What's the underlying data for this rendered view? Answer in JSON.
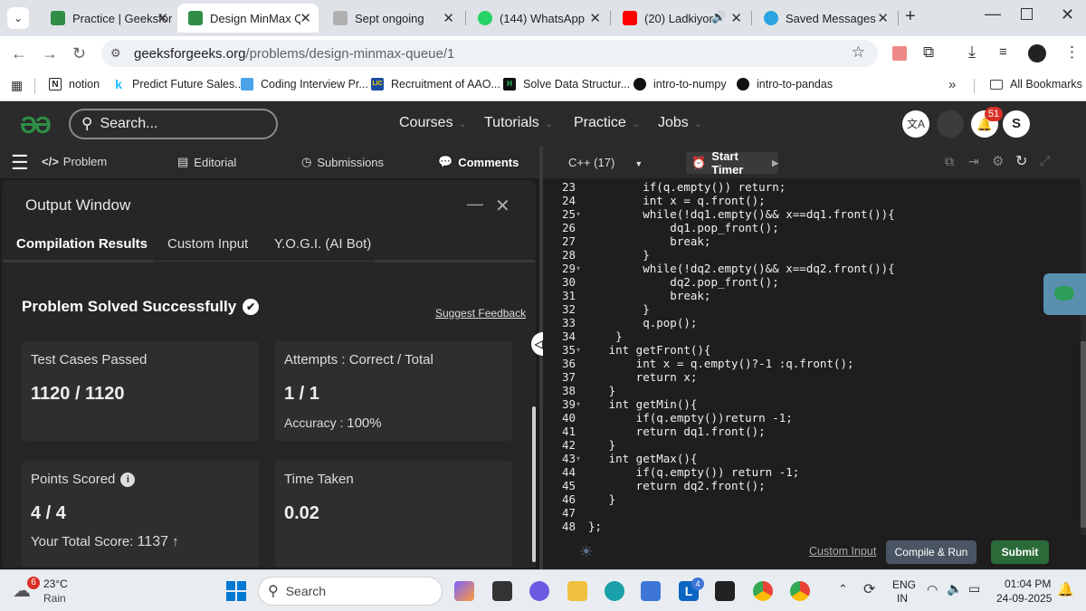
{
  "browser": {
    "tabs": [
      {
        "label": "Practice | Geeksfor",
        "color": "#2f8d46"
      },
      {
        "label": "Design MinMax Qu",
        "color": "#2f8d46",
        "active": true
      },
      {
        "label": "Sept ongoing",
        "color": "#9a9a9a"
      },
      {
        "label": "(144) WhatsApp",
        "color": "#25d366"
      },
      {
        "label": "(20) Ladkiyon k",
        "color": "#ff0000"
      },
      {
        "label": "Saved Messages",
        "color": "#2aa3e0"
      }
    ],
    "url_host": "geeksforgeeks.org",
    "url_path": "/problems/design-minmax-queue/1",
    "bookmarks": [
      {
        "label": "notion"
      },
      {
        "label": "Predict Future Sales..."
      },
      {
        "label": "Coding Interview Pr..."
      },
      {
        "label": "Recruitment of AAO..."
      },
      {
        "label": "Solve Data Structur..."
      },
      {
        "label": "intro-to-numpy"
      },
      {
        "label": "intro-to-pandas"
      }
    ],
    "all_bookmarks": "All Bookmarks"
  },
  "gfg": {
    "search_placeholder": "Search...",
    "menu": [
      "Courses",
      "Tutorials",
      "Practice",
      "Jobs"
    ],
    "notification_count": "51",
    "avatar_letter": "S"
  },
  "left_tabs": [
    "Problem",
    "Editorial",
    "Submissions",
    "Comments"
  ],
  "output": {
    "title": "Output Window",
    "subtabs": [
      "Compilation Results",
      "Custom Input",
      "Y.O.G.I. (AI Bot)"
    ],
    "success": "Problem Solved Successfully",
    "suggest_feedback": "Suggest Feedback",
    "test_cases_label": "Test Cases Passed",
    "test_cases_value": "1120 / 1120",
    "attempts_label": "Attempts : Correct / Total",
    "attempts_value": "1 / 1",
    "accuracy_label": "Accuracy :",
    "accuracy_value": "100%",
    "points_label": "Points Scored",
    "points_value": "4 / 4",
    "total_score_label": "Your Total Score:",
    "total_score_value": "1137",
    "time_label": "Time Taken",
    "time_value": "0.02"
  },
  "editor": {
    "language": "C++ (17)",
    "start_timer": "Start Timer",
    "lines": [
      {
        "n": "23",
        "code": "        if(q.empty()) return;"
      },
      {
        "n": "24",
        "code": "        int x = q.front();"
      },
      {
        "n": "25",
        "code": "        while(!dq1.empty()&& x==dq1.front()){"
      },
      {
        "n": "26",
        "code": "            dq1.pop_front();"
      },
      {
        "n": "27",
        "code": "            break;"
      },
      {
        "n": "28",
        "code": "        }"
      },
      {
        "n": "29",
        "code": "        while(!dq2.empty()&& x==dq2.front()){"
      },
      {
        "n": "30",
        "code": "            dq2.pop_front();"
      },
      {
        "n": "31",
        "code": "            break;"
      },
      {
        "n": "32",
        "code": "        }"
      },
      {
        "n": "33",
        "code": "        q.pop();"
      },
      {
        "n": "34",
        "code": "    }"
      },
      {
        "n": "35",
        "code": "   int getFront(){"
      },
      {
        "n": "36",
        "code": "       int x = q.empty()?-1 :q.front();"
      },
      {
        "n": "37",
        "code": "       return x;"
      },
      {
        "n": "38",
        "code": "   }"
      },
      {
        "n": "39",
        "code": "   int getMin(){"
      },
      {
        "n": "40",
        "code": "       if(q.empty())return -1;"
      },
      {
        "n": "41",
        "code": "       return dq1.front();"
      },
      {
        "n": "42",
        "code": "   }"
      },
      {
        "n": "43",
        "code": "   int getMax(){"
      },
      {
        "n": "44",
        "code": "       if(q.empty()) return -1;"
      },
      {
        "n": "45",
        "code": "       return dq2.front();"
      },
      {
        "n": "46",
        "code": "   }"
      },
      {
        "n": "47",
        "code": ""
      },
      {
        "n": "48",
        "code": "};"
      }
    ],
    "custom_input": "Custom Input",
    "compile_run": "Compile & Run",
    "submit": "Submit"
  },
  "taskbar": {
    "weather_badge": "6",
    "temp": "23°C",
    "weather": "Rain",
    "search": "Search",
    "lang1": "ENG",
    "lang2": "IN",
    "time": "01:04 PM",
    "date": "24-09-2025",
    "badge_4": "4"
  }
}
